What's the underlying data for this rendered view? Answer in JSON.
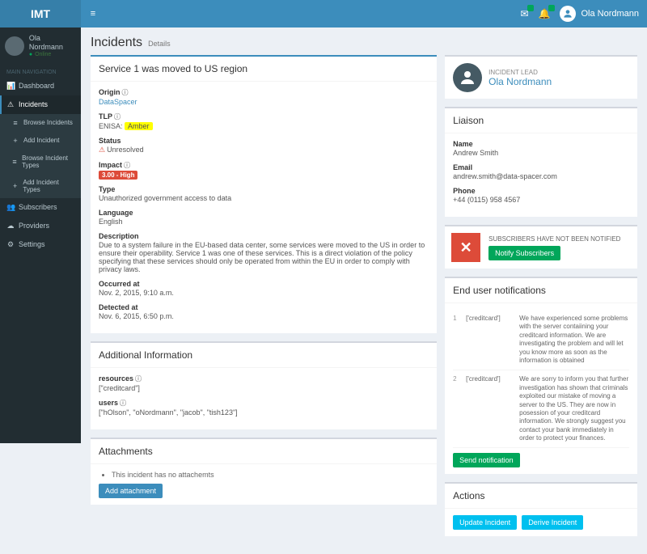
{
  "brand": "IMT",
  "user": {
    "name": "Ola Nordmann",
    "status": "Online"
  },
  "nav": {
    "header": "MAIN NAVIGATION",
    "items": [
      {
        "icon": "📊",
        "label": "Dashboard"
      },
      {
        "icon": "⚠",
        "label": "Incidents",
        "active": true
      },
      {
        "icon": "≡",
        "label": "Browse Incidents",
        "sub": true
      },
      {
        "icon": "+",
        "label": "Add Incident",
        "sub": true
      },
      {
        "icon": "≡",
        "label": "Browse Incident Types",
        "sub": true
      },
      {
        "icon": "+",
        "label": "Add Incident Types",
        "sub": true
      },
      {
        "icon": "👥",
        "label": "Subscribers"
      },
      {
        "icon": "☁",
        "label": "Providers"
      },
      {
        "icon": "⚙",
        "label": "Settings"
      }
    ]
  },
  "page": {
    "title": "Incidents",
    "subtitle": "Details"
  },
  "incident": {
    "title": "Service 1 was moved to US region",
    "origin_label": "Origin",
    "origin": "DataSpacer",
    "tlp_label": "TLP",
    "tlp_prefix": "ENISA:",
    "tlp": "Amber",
    "status_label": "Status",
    "status": "Unresolved",
    "impact_label": "Impact",
    "impact": "3.00 - High",
    "type_label": "Type",
    "type": "Unauthorized government access to data",
    "language_label": "Language",
    "language": "English",
    "description_label": "Description",
    "description": "Due to a system failure in the EU-based data center, some services were moved to the US in order to ensure their operability. Service 1 was one of these services. This is a direct violation of the policy specifying that these services should only be operated from within the EU in order to comply with privacy laws.",
    "occurred_label": "Occurred at",
    "occurred": "Nov. 2, 2015, 9:10 a.m.",
    "detected_label": "Detected at",
    "detected": "Nov. 6, 2015, 6:50 p.m."
  },
  "additional": {
    "title": "Additional Information",
    "resources_label": "resources",
    "resources": "[\"creditcard\"]",
    "users_label": "users",
    "users": "[\"hOlson\", \"oNordmann\", \"jacob\", \"tish123\"]"
  },
  "attachments": {
    "title": "Attachments",
    "empty": "This incident has no attachemts",
    "button": "Add attachment"
  },
  "lead": {
    "role": "INCIDENT LEAD",
    "name": "Ola Nordmann"
  },
  "liaison": {
    "title": "Liaison",
    "name_label": "Name",
    "name": "Andrew Smith",
    "email_label": "Email",
    "email": "andrew.smith@data-spacer.com",
    "phone_label": "Phone",
    "phone": "+44 (0115) 958 4567"
  },
  "notify": {
    "text": "SUBSCRIBERS HAVE NOT BEEN NOTIFIED",
    "button": "Notify Subscribers"
  },
  "notifications": {
    "title": "End user notifications",
    "items": [
      {
        "num": "1",
        "tag": "['creditcard']",
        "msg": "We have experienced some problems with the server contaiining your creditcard information. We are investigating the problem and will let you know more as soon as the information is obtained"
      },
      {
        "num": "2",
        "tag": "['creditcard']",
        "msg": "We are sorry to inform you that further investigation has shown that criminals exploited our mistake of moving a server to the US. They are now in posession of your creditcard information. We strongly suggest you contact your bank immediately in order to protect your finances."
      }
    ],
    "button": "Send notification"
  },
  "actions": {
    "title": "Actions",
    "update": "Update Incident",
    "derive": "Derive Incident"
  }
}
